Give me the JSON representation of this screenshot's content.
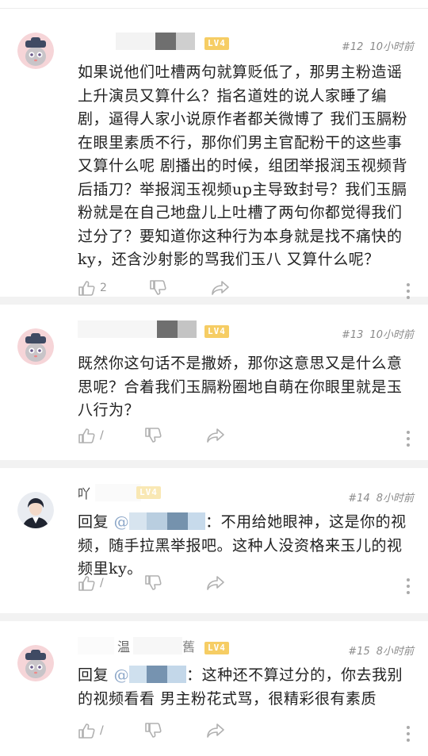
{
  "comments": [
    {
      "floor": "#12",
      "time": "10小时前",
      "level": "LV4",
      "text": "如果说他们吐槽两句就算贬低了，那男主粉造谣上升演员又算什么？指名道姓的说人家睡了编剧，逼得人家小说原作者都关微博了 我们玉膈粉在眼里素质不行，那你们男主官配粉干的这些事又算什么呢 剧播出的时候，组团举报润玉视频背后插刀？举报润玉视频up主导致封号？我们玉膈粉就是在自己地盘儿上吐槽了两句你都觉得我们过分了？要知道你这种行为本身就是找不痛快的ky，还含沙射影的骂我们玉八 又算什么呢？",
      "likes": "2"
    },
    {
      "floor": "#13",
      "time": "10小时前",
      "level": "LV4",
      "text": "既然你这句话不是撒娇，那你这意思又是什么意思呢？合着我们玉膈粉圈地自萌在你眼里就是玉八行为？",
      "likes": "/"
    },
    {
      "floor": "#14",
      "time": "8小时前",
      "level": "LV4",
      "name_fragment": "吖",
      "reply_prefix": "回复",
      "mention": "@",
      "text": "：不用给她眼神，这是你的视频，随手拉黑举报吧。这种人没资格来玉儿的视频里ky。",
      "likes": "/"
    },
    {
      "floor": "#15",
      "time": "8小时前",
      "level": "LV4",
      "name_fragment": "温",
      "name_fragment2": "舊",
      "reply_prefix": "回复",
      "mention": "@",
      "text": "：这种还不算过分的，你去我别的视频看看 男主粉花式骂，很精彩很有素质",
      "likes": "/"
    }
  ],
  "icons": [
    "like-icon",
    "dislike-icon",
    "share-icon",
    "more-icon"
  ],
  "colors": {
    "level_badge": "#f6cd64",
    "mention": "#8aa5c7",
    "meta": "#8a8a8a",
    "divider": "#f2f2f2"
  }
}
